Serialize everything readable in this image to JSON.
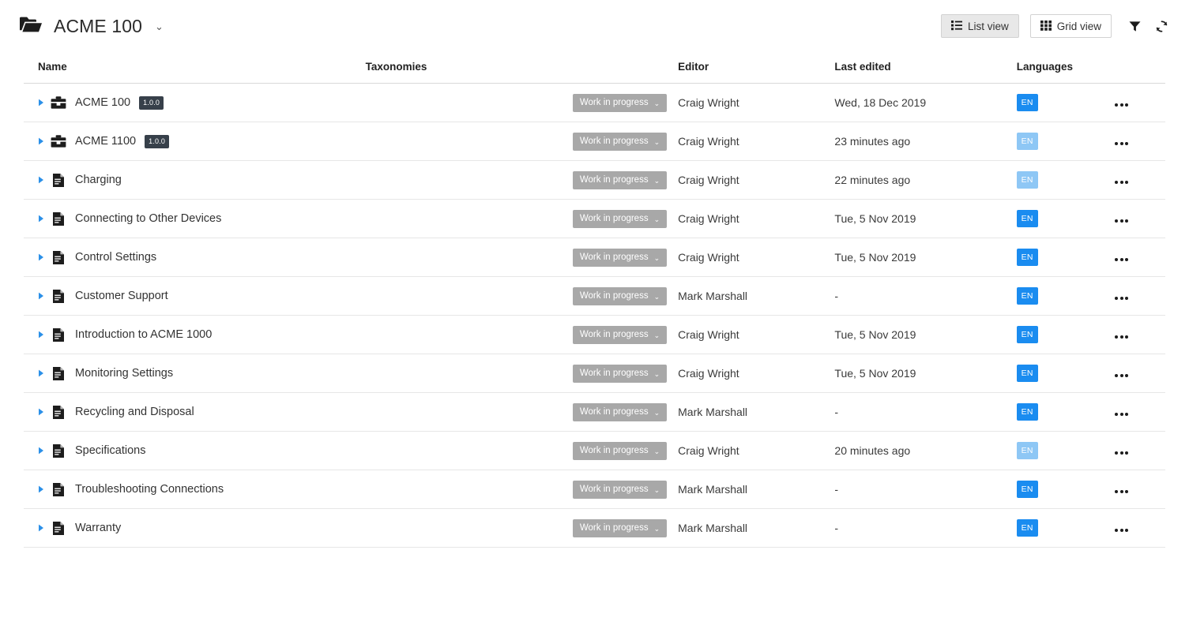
{
  "header": {
    "folder_icon": "open-folder-icon",
    "title": "ACME 100",
    "title_caret": "⌄",
    "view_toggle": [
      {
        "label": "List view",
        "icon": "list-view-icon",
        "active": true
      },
      {
        "label": "Grid view",
        "icon": "grid-view-icon",
        "active": false
      }
    ],
    "actions": [
      {
        "name": "filter-icon",
        "label": "Filter"
      },
      {
        "name": "refresh-icon",
        "label": "Refresh"
      }
    ]
  },
  "table": {
    "columns": [
      "Name",
      "Taxonomies",
      "Editor",
      "Last edited",
      "Languages"
    ],
    "row_menu_label": "•••",
    "status_chevron": "⌄",
    "rows": [
      {
        "name": "ACME 100",
        "icon": "publication-icon",
        "version": "1.0.0",
        "taxonomies": "",
        "status": "Work in progress",
        "editor": "Craig Wright",
        "last_edited": "Wed, 18 Dec 2019",
        "language": "EN",
        "language_faded": false
      },
      {
        "name": "ACME 1100",
        "icon": "publication-icon",
        "version": "1.0.0",
        "taxonomies": "",
        "status": "Work in progress",
        "editor": "Craig Wright",
        "last_edited": "23 minutes ago",
        "language": "EN",
        "language_faded": true
      },
      {
        "name": "Charging",
        "icon": "topic-icon",
        "version": "",
        "taxonomies": "",
        "status": "Work in progress",
        "editor": "Craig Wright",
        "last_edited": "22 minutes ago",
        "language": "EN",
        "language_faded": true
      },
      {
        "name": "Connecting to Other Devices",
        "icon": "topic-icon",
        "version": "",
        "taxonomies": "",
        "status": "Work in progress",
        "editor": "Craig Wright",
        "last_edited": "Tue, 5 Nov 2019",
        "language": "EN",
        "language_faded": false
      },
      {
        "name": "Control Settings",
        "icon": "topic-icon",
        "version": "",
        "taxonomies": "",
        "status": "Work in progress",
        "editor": "Craig Wright",
        "last_edited": "Tue, 5 Nov 2019",
        "language": "EN",
        "language_faded": false
      },
      {
        "name": "Customer Support",
        "icon": "topic-icon",
        "version": "",
        "taxonomies": "",
        "status": "Work in progress",
        "editor": "Mark Marshall",
        "last_edited": "-",
        "language": "EN",
        "language_faded": false
      },
      {
        "name": "Introduction to ACME 1000",
        "icon": "topic-icon",
        "version": "",
        "taxonomies": "",
        "status": "Work in progress",
        "editor": "Craig Wright",
        "last_edited": "Tue, 5 Nov 2019",
        "language": "EN",
        "language_faded": false
      },
      {
        "name": "Monitoring Settings",
        "icon": "topic-icon",
        "version": "",
        "taxonomies": "",
        "status": "Work in progress",
        "editor": "Craig Wright",
        "last_edited": "Tue, 5 Nov 2019",
        "language": "EN",
        "language_faded": false
      },
      {
        "name": "Recycling and Disposal",
        "icon": "topic-icon",
        "version": "",
        "taxonomies": "",
        "status": "Work in progress",
        "editor": "Mark Marshall",
        "last_edited": "-",
        "language": "EN",
        "language_faded": false
      },
      {
        "name": "Specifications",
        "icon": "topic-icon",
        "version": "",
        "taxonomies": "",
        "status": "Work in progress",
        "editor": "Craig Wright",
        "last_edited": "20 minutes ago",
        "language": "EN",
        "language_faded": true
      },
      {
        "name": "Troubleshooting Connections",
        "icon": "topic-icon",
        "version": "",
        "taxonomies": "",
        "status": "Work in progress",
        "editor": "Mark Marshall",
        "last_edited": "-",
        "language": "EN",
        "language_faded": false
      },
      {
        "name": "Warranty",
        "icon": "topic-icon",
        "version": "",
        "taxonomies": "",
        "status": "Work in progress",
        "editor": "Mark Marshall",
        "last_edited": "-",
        "language": "EN",
        "language_faded": false
      }
    ]
  },
  "colors": {
    "accent_blue": "#1a8cf0",
    "accent_blue_faded": "#8ec7f5",
    "status_gray": "#a8a8a8",
    "version_badge": "#37404a"
  }
}
